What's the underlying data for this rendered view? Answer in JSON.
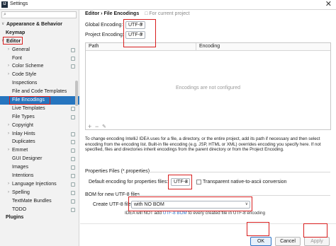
{
  "window": {
    "title": "Settings",
    "app_icon": "IJ"
  },
  "sidebar": {
    "search_placeholder": "",
    "items": [
      {
        "label": "Appearance & Behavior",
        "level": 0,
        "arrow": "v"
      },
      {
        "label": "Keymap",
        "level": 0,
        "arrow": ""
      },
      {
        "label": "Editor",
        "level": 0,
        "arrow": "v"
      },
      {
        "label": "General",
        "level": 1,
        "arrow": ">"
      },
      {
        "label": "Font",
        "level": 1,
        "arrow": ""
      },
      {
        "label": "Color Scheme",
        "level": 1,
        "arrow": ">"
      },
      {
        "label": "Code Style",
        "level": 1,
        "arrow": ">"
      },
      {
        "label": "Inspections",
        "level": 1,
        "arrow": ""
      },
      {
        "label": "File and Code Templates",
        "level": 1,
        "arrow": ""
      },
      {
        "label": "File Encodings",
        "level": 1,
        "arrow": ""
      },
      {
        "label": "Live Templates",
        "level": 1,
        "arrow": ""
      },
      {
        "label": "File Types",
        "level": 1,
        "arrow": ""
      },
      {
        "label": "Copyright",
        "level": 1,
        "arrow": ">"
      },
      {
        "label": "Inlay Hints",
        "level": 1,
        "arrow": ">"
      },
      {
        "label": "Duplicates",
        "level": 1,
        "arrow": ""
      },
      {
        "label": "Emmet",
        "level": 1,
        "arrow": ">"
      },
      {
        "label": "GUI Designer",
        "level": 1,
        "arrow": ""
      },
      {
        "label": "Images",
        "level": 1,
        "arrow": ""
      },
      {
        "label": "Intentions",
        "level": 1,
        "arrow": ""
      },
      {
        "label": "Language Injections",
        "level": 1,
        "arrow": ">"
      },
      {
        "label": "Spelling",
        "level": 1,
        "arrow": ">"
      },
      {
        "label": "TextMate Bundles",
        "level": 1,
        "arrow": ""
      },
      {
        "label": "TODO",
        "level": 1,
        "arrow": ""
      },
      {
        "label": "Plugins",
        "level": 0,
        "arrow": ""
      }
    ],
    "selected": "File Encodings"
  },
  "main": {
    "breadcrumb": "Editor  ›  File Encodings",
    "for_current_project": "For current project",
    "global_encoding_label": "Global Encoding:",
    "global_encoding_value": "UTF-8",
    "project_encoding_label": "Project Encoding:",
    "project_encoding_value": "UTF-8",
    "table": {
      "col_path": "Path",
      "col_encoding": "Encoding",
      "empty_text": "Encodings are not configured",
      "add": "+",
      "remove": "−",
      "edit": "✎"
    },
    "description": "To change encoding IntelliJ IDEA uses for a file, a directory, or the entire project, add its path if necessary and then select encoding from the encoding list. Built-in file encoding (e.g. JSP, HTML or XML) overrides encoding you specify here. If not specified, files and directories inherit encodings from the parent directory or from the Project Encoding.",
    "properties_title": "Properties Files (*.properties)",
    "properties_label": "Default encoding for properties files:",
    "properties_value": "UTF-8",
    "native_ascii_label": "Transparent native-to-ascii conversion",
    "bom_title": "BOM for new UTF-8 files",
    "bom_label": "Create UTF-8 files:",
    "bom_value": "with NO BOM",
    "hint_prefix": "IDEA will NOT add",
    "hint_link": "UTF-8 BOM",
    "hint_suffix": "to every created file in UTF-8 encoding"
  },
  "buttons": {
    "ok": "OK",
    "cancel": "Cancel",
    "apply": "Apply"
  },
  "colors": {
    "selection": "#2675bf",
    "annotation": "#d81e1e"
  }
}
